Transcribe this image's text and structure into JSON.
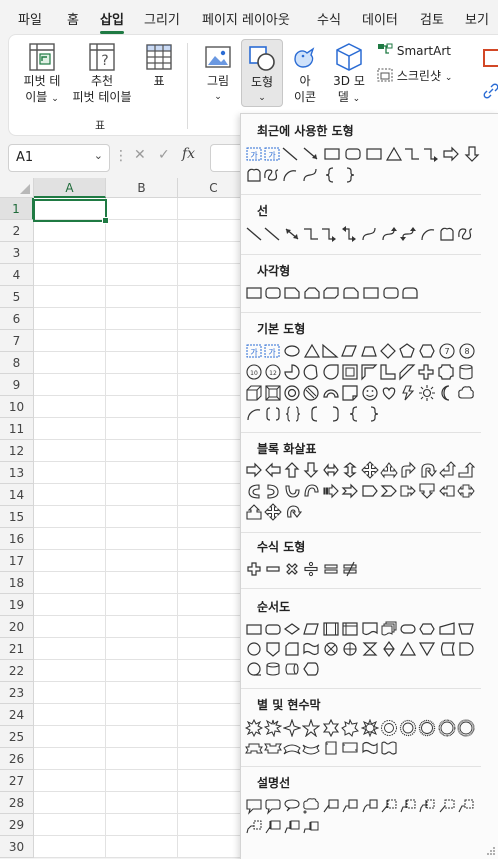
{
  "tabs": [
    "파일",
    "홈",
    "삽입",
    "그리기",
    "페이지 레이아웃",
    "수식",
    "데이터",
    "검토",
    "보기"
  ],
  "active_tab": "삽입",
  "ribbon": {
    "pivot_table": [
      "피벗 테",
      "이블"
    ],
    "recommended_pivot": [
      "추천",
      "피벗 테이블"
    ],
    "table": "표",
    "group_table": "표",
    "picture": "그림",
    "shapes": "도형",
    "icons": [
      "아",
      "이콘"
    ],
    "models_3d": [
      "3D 모",
      "델"
    ],
    "smartart": "SmartArt",
    "screenshot": "스크린샷"
  },
  "formula_bar": {
    "name_box": "A1",
    "fx": "fx"
  },
  "grid": {
    "columns": [
      "A",
      "B",
      "C"
    ],
    "rows": [
      "1",
      "2",
      "3",
      "4",
      "5",
      "6",
      "7",
      "8",
      "9",
      "10",
      "11",
      "12",
      "13",
      "14",
      "15",
      "16",
      "17",
      "18",
      "19",
      "20",
      "21",
      "22",
      "23",
      "24",
      "25",
      "26",
      "27",
      "28",
      "29",
      "30"
    ]
  },
  "shapes_gallery": {
    "sections": [
      {
        "title": "최근에 사용한 도형"
      },
      {
        "title": "선"
      },
      {
        "title": "사각형"
      },
      {
        "title": "기본 도형"
      },
      {
        "title": "블록 화살표"
      },
      {
        "title": "수식 도형"
      },
      {
        "title": "순서도"
      },
      {
        "title": "별 및 현수막"
      },
      {
        "title": "설명선"
      }
    ]
  },
  "colors": {
    "accent": "#1f7a43",
    "shape_outline": "#333333",
    "textbox_blue": "#2b6cd4"
  }
}
